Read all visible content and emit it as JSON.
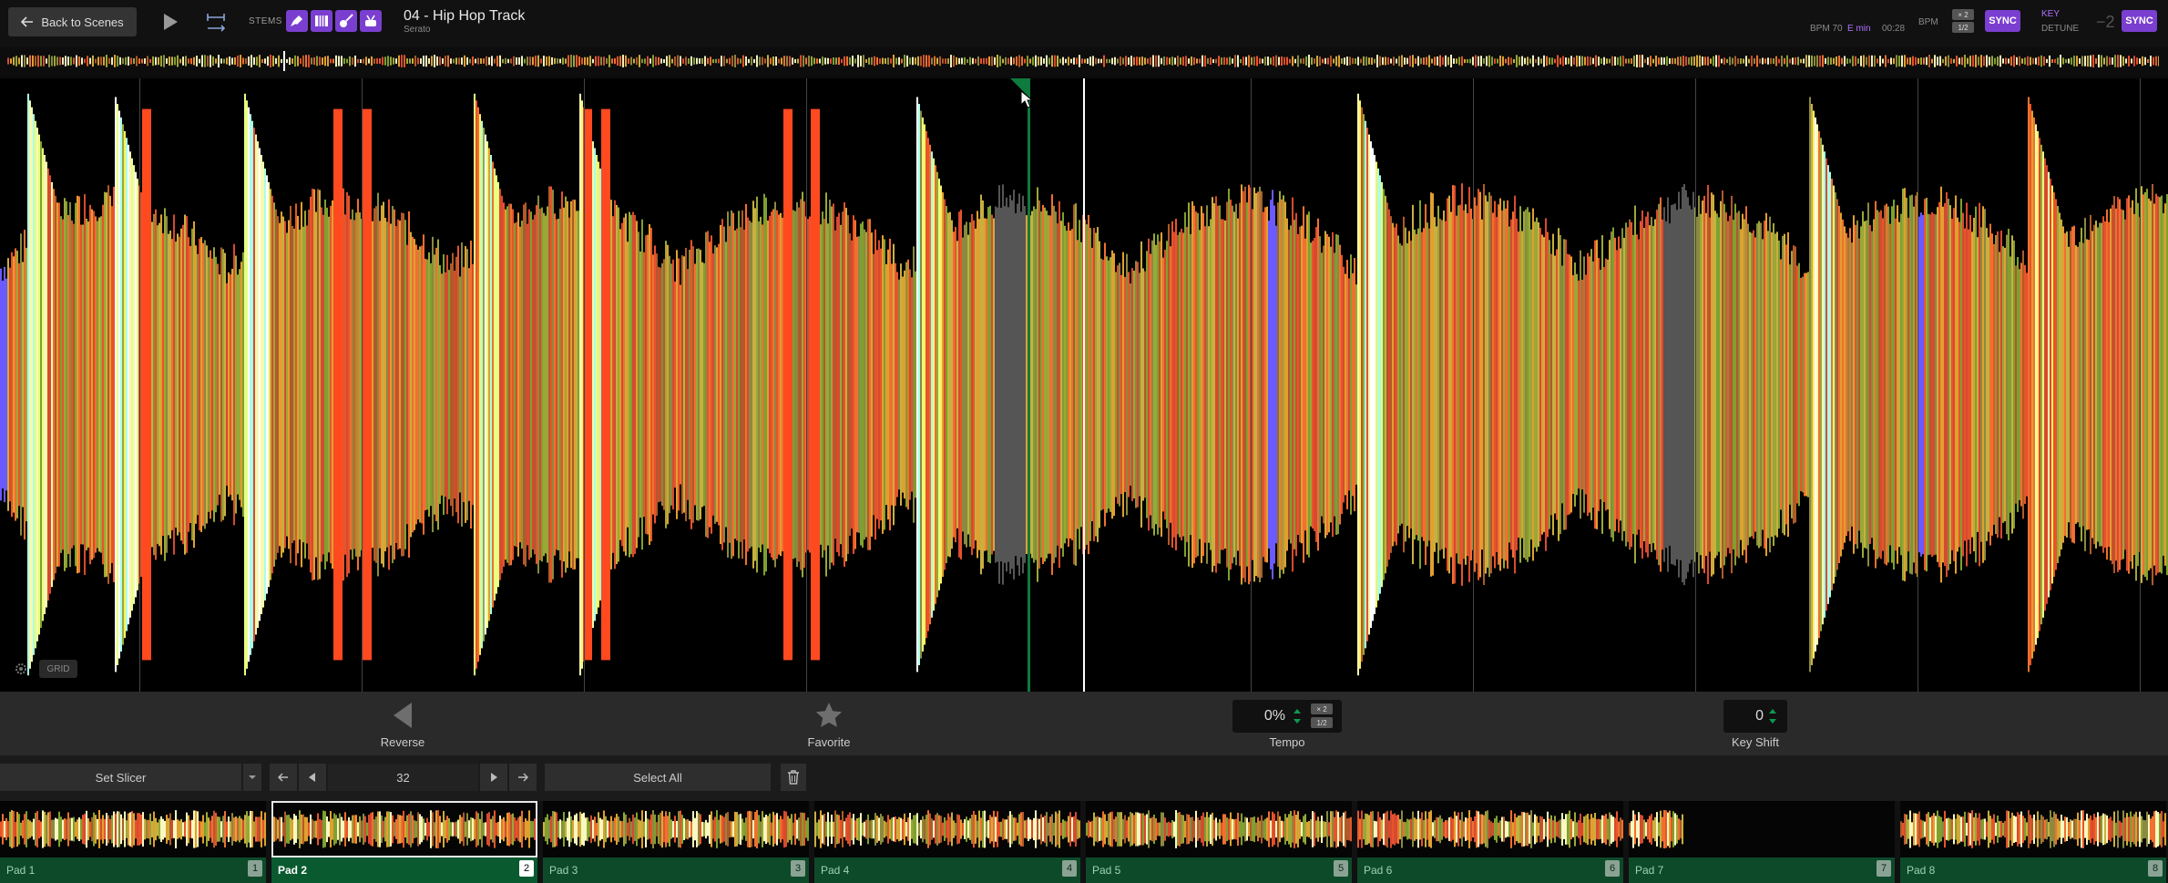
{
  "header": {
    "back_label": "Back to Scenes",
    "stems_label": "STEMS",
    "track_title": "04 - Hip Hop Track",
    "track_artist": "Serato",
    "bpm_readout": "BPM 70",
    "key_readout": "E min",
    "time_readout": "00:28",
    "bpm_label": "BPM",
    "multiplier_top": "× 2",
    "multiplier_bottom": "1/2",
    "sync_label": "SYNC",
    "key_label": "KEY",
    "detune_label": "DETUNE",
    "detune_value": "−2",
    "stem_icons": [
      "vocal-mic-icon",
      "piano-keys-icon",
      "guitar-icon",
      "drums-icon"
    ],
    "accent_color": "#7a3fd0"
  },
  "waveform": {
    "grid_label": "GRID",
    "marker_color": "#0e7a3e"
  },
  "controls": {
    "reverse_label": "Reverse",
    "favorite_label": "Favorite",
    "tempo_value": "0%",
    "tempo_label": "Tempo",
    "tempo_mult_top": "× 2",
    "tempo_mult_bottom": "1/2",
    "keyshift_value": "0",
    "keyshift_label": "Key Shift"
  },
  "slicer": {
    "mode_label": "Set Slicer",
    "slice_count": "32",
    "select_all_label": "Select All"
  },
  "pads": [
    {
      "label": "Pad 1",
      "num": "1"
    },
    {
      "label": "Pad 2",
      "num": "2"
    },
    {
      "label": "Pad 3",
      "num": "3"
    },
    {
      "label": "Pad 4",
      "num": "4"
    },
    {
      "label": "Pad 5",
      "num": "5"
    },
    {
      "label": "Pad 6",
      "num": "6"
    },
    {
      "label": "Pad 7",
      "num": "7"
    },
    {
      "label": "Pad 8",
      "num": "8"
    }
  ]
}
